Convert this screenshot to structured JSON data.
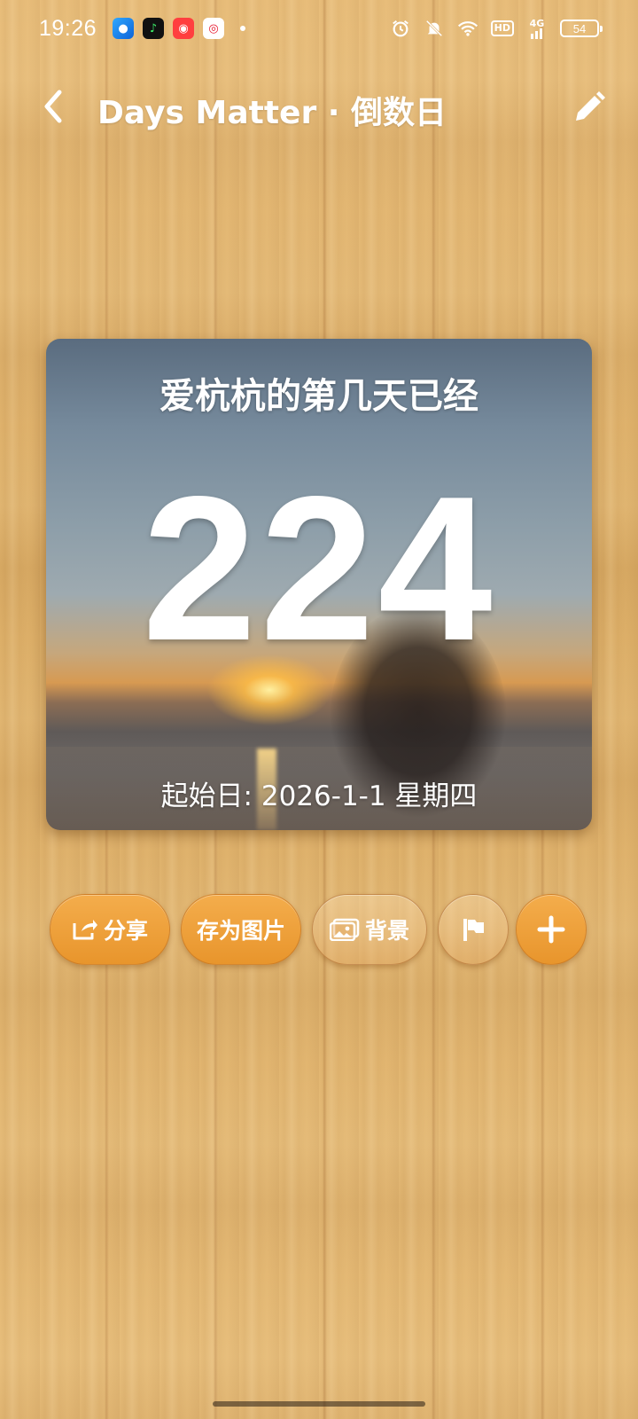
{
  "status_bar": {
    "time": "19:26",
    "app_icons": [
      "app-blue-icon",
      "music-app-icon",
      "red-app-icon",
      "weibo-icon"
    ],
    "network_label": "4G",
    "hd_label": "HD",
    "battery": "54"
  },
  "app_bar": {
    "title": "Days Matter · 倒数日",
    "back_icon": "back-chevron-icon",
    "edit_icon": "pencil-icon"
  },
  "card": {
    "title": "爱杭杭的第几天已经",
    "days": "224",
    "start_date": "起始日: 2026-1-1 星期四"
  },
  "actions": {
    "share_label": "分享",
    "save_image_label": "存为图片",
    "background_label": "背景"
  },
  "colors": {
    "accent_orange": "#ee9d36",
    "text": "#ffffff",
    "wood": "#e3b56f"
  }
}
